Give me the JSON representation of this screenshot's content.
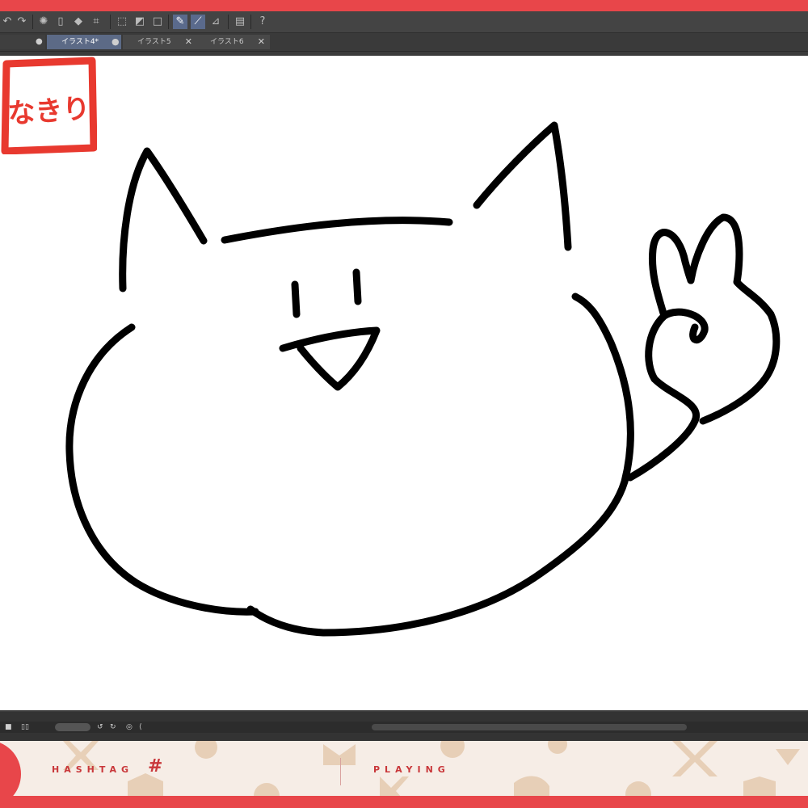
{
  "tabs": [
    {
      "label": "イラスト4*",
      "active": true
    },
    {
      "label": "イラスト5",
      "active": false
    },
    {
      "label": "イラスト6",
      "active": false
    }
  ],
  "toolbar_icons": [
    "undo-icon",
    "redo-icon",
    "loading-icon",
    "clipboard-icon",
    "fill-icon",
    "crop-icon",
    "selection-icon",
    "shape-icon",
    "square-icon",
    "pen-icon",
    "brush-icon",
    "ruler-icon",
    "panel-icon",
    "help-icon"
  ],
  "stamp": {
    "text": "なきり",
    "color": "#e8392f"
  },
  "banner": {
    "hashtag_label": "HASHTAG",
    "hash_symbol": "#",
    "playing_label": "PLAYING"
  },
  "colors": {
    "frame": "#e8464a",
    "ui_dark": "#3b3b3b",
    "accent_tab": "#5c6a86",
    "banner_bg": "#f6ede6",
    "banner_text": "#c9373a"
  }
}
